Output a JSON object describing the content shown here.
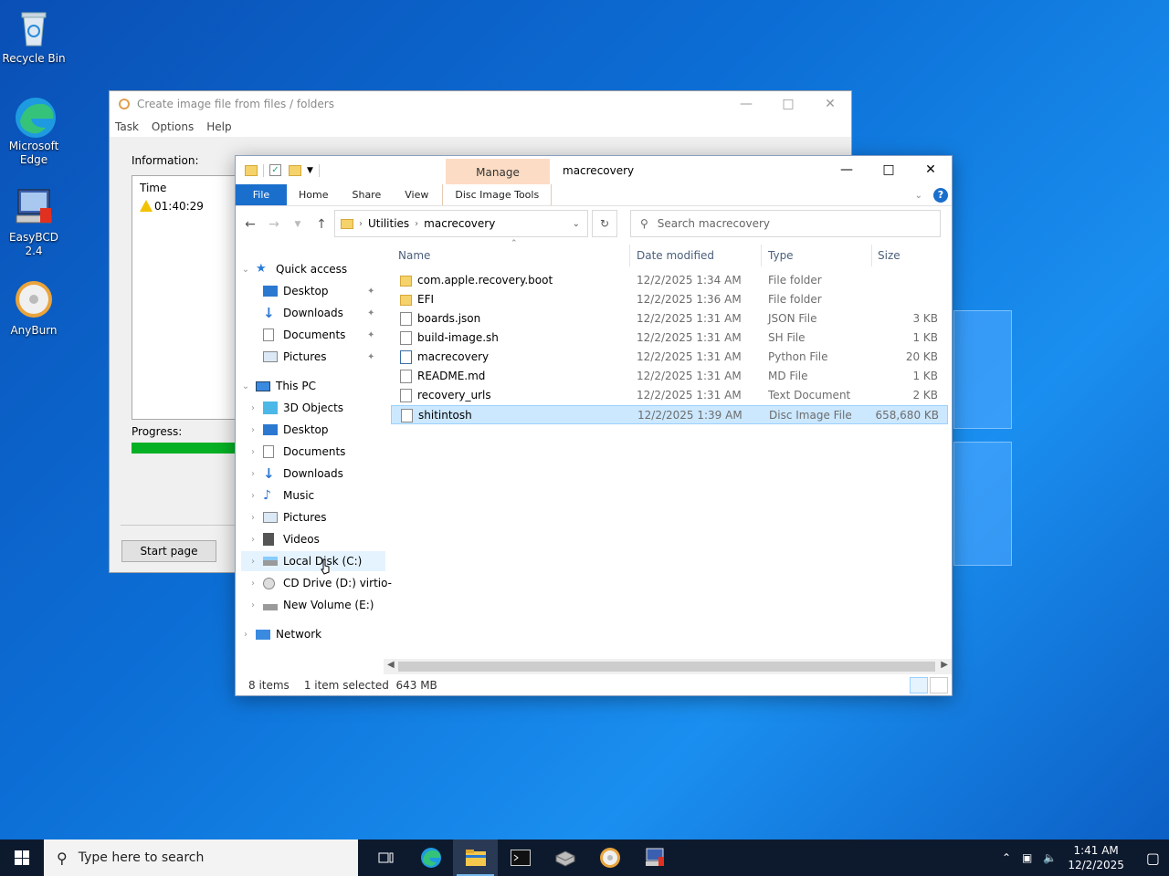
{
  "desktop": {
    "icons": [
      {
        "label": "Recycle Bin",
        "icon": "recycle-bin-icon"
      },
      {
        "label": "Microsoft Edge",
        "icon": "edge-icon"
      },
      {
        "label": "EasyBCD 2.4",
        "icon": "easybcd-icon"
      },
      {
        "label": "AnyBurn",
        "icon": "anyburn-icon"
      }
    ]
  },
  "anyburn": {
    "title": "Create image file from files / folders",
    "menu": [
      "Task",
      "Options",
      "Help"
    ],
    "info_label": "Information:",
    "info_header": "Time",
    "info_time": "01:40:29",
    "progress_label": "Progress:",
    "progress_value": 0.9,
    "start_page_label": "Start page"
  },
  "explorer": {
    "title": "macrecovery",
    "manage_label": "Manage",
    "ribbon_tabs": [
      "File",
      "Home",
      "Share",
      "View",
      "Disc Image Tools"
    ],
    "breadcrumb": [
      "Utilities",
      "macrecovery"
    ],
    "search_placeholder": "Search macrecovery",
    "nav": {
      "quick_access": "Quick access",
      "qa_items": [
        "Desktop",
        "Downloads",
        "Documents",
        "Pictures"
      ],
      "this_pc": "This PC",
      "pc_items": [
        "3D Objects",
        "Desktop",
        "Documents",
        "Downloads",
        "Music",
        "Pictures",
        "Videos",
        "Local Disk (C:)",
        "CD Drive (D:) virtio-",
        "New Volume (E:)"
      ],
      "network": "Network"
    },
    "columns": {
      "name": "Name",
      "date": "Date modified",
      "type": "Type",
      "size": "Size"
    },
    "files": [
      {
        "name": "com.apple.recovery.boot",
        "date": "12/2/2025 1:34 AM",
        "type": "File folder",
        "size": "",
        "icon": "folder"
      },
      {
        "name": "EFI",
        "date": "12/2/2025 1:36 AM",
        "type": "File folder",
        "size": "",
        "icon": "folder"
      },
      {
        "name": "boards.json",
        "date": "12/2/2025 1:31 AM",
        "type": "JSON File",
        "size": "3 KB",
        "icon": "doc"
      },
      {
        "name": "build-image.sh",
        "date": "12/2/2025 1:31 AM",
        "type": "SH File",
        "size": "1 KB",
        "icon": "doc"
      },
      {
        "name": "macrecovery",
        "date": "12/2/2025 1:31 AM",
        "type": "Python File",
        "size": "20 KB",
        "icon": "py"
      },
      {
        "name": "README.md",
        "date": "12/2/2025 1:31 AM",
        "type": "MD File",
        "size": "1 KB",
        "icon": "doc"
      },
      {
        "name": "recovery_urls",
        "date": "12/2/2025 1:31 AM",
        "type": "Text Document",
        "size": "2 KB",
        "icon": "doc"
      },
      {
        "name": "shitintosh",
        "date": "12/2/2025 1:39 AM",
        "type": "Disc Image File",
        "size": "658,680 KB",
        "icon": "iso"
      }
    ],
    "status_count": "8 items",
    "status_selected": "1 item selected",
    "status_size": "643 MB"
  },
  "taskbar": {
    "search_placeholder": "Type here to search",
    "time": "1:41 AM",
    "date": "12/2/2025",
    "apps": [
      "task-view-icon",
      "edge-icon",
      "file-explorer-icon",
      "terminal-icon",
      "package-icon",
      "anyburn-icon",
      "easybcd-icon"
    ]
  }
}
